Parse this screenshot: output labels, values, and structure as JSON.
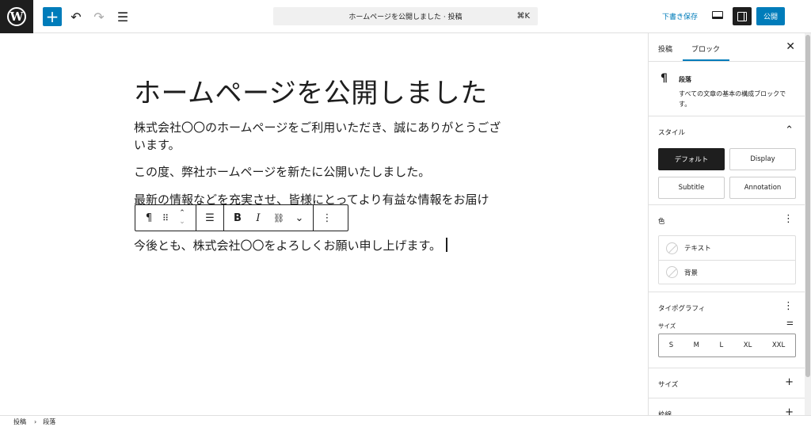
{
  "topbar": {
    "logo_letter": "W",
    "add_icon": "+",
    "undo_icon": "↶",
    "redo_icon": "↷",
    "list_view_icon": "☰",
    "command_text": "ホームページを公開しました · 投稿",
    "command_shortcut": "⌘K",
    "save_draft_label": "下書き保存",
    "publish_label": "公開"
  },
  "editor": {
    "title": "ホームページを公開しました",
    "paragraphs": [
      "株式会社〇〇のホームページをご利用いただき、誠にありがとうございます。",
      "この度、弊社ホームページを新たに公開いたしました。",
      "最新の情報などを充実させ、皆様にとってより有益な情報をお届け",
      "今後とも、株式会社〇〇をよろしくお願い申し上げます。"
    ],
    "toolbar": {
      "paragraph_icon": "¶",
      "drag_icon": "⠿",
      "move_up_icon": "⌃",
      "move_down_icon": "⌄",
      "align_icon": "☰",
      "bold_label": "B",
      "italic_label": "I",
      "link_icon": "⛓",
      "more_rich_icon": "⌄",
      "options_icon": "⋮"
    }
  },
  "sidebar": {
    "tabs": [
      "投稿",
      "ブロック"
    ],
    "close_icon": "✕",
    "block": {
      "icon": "¶",
      "name": "段落",
      "description": "すべての文章の基本の構成ブロックです。"
    },
    "style": {
      "title": "スタイル",
      "toggle_icon": "⌃",
      "options": [
        "デフォルト",
        "Display",
        "Subtitle",
        "Annotation"
      ]
    },
    "color": {
      "title": "色",
      "menu_icon": "⋮",
      "items": [
        "テキスト",
        "背景"
      ]
    },
    "typography": {
      "title": "タイポグラフィ",
      "menu_icon": "⋮",
      "size_label": "サイズ",
      "adjust_icon": "⚌",
      "sizes": [
        "S",
        "M",
        "L",
        "XL",
        "XXL"
      ]
    },
    "size_panel": {
      "title": "サイズ",
      "icon": "+"
    },
    "border_panel": {
      "title": "枠線",
      "icon": "+"
    }
  },
  "footer": {
    "breadcrumb": [
      "投稿",
      "段落"
    ],
    "separator_icon": "›"
  }
}
